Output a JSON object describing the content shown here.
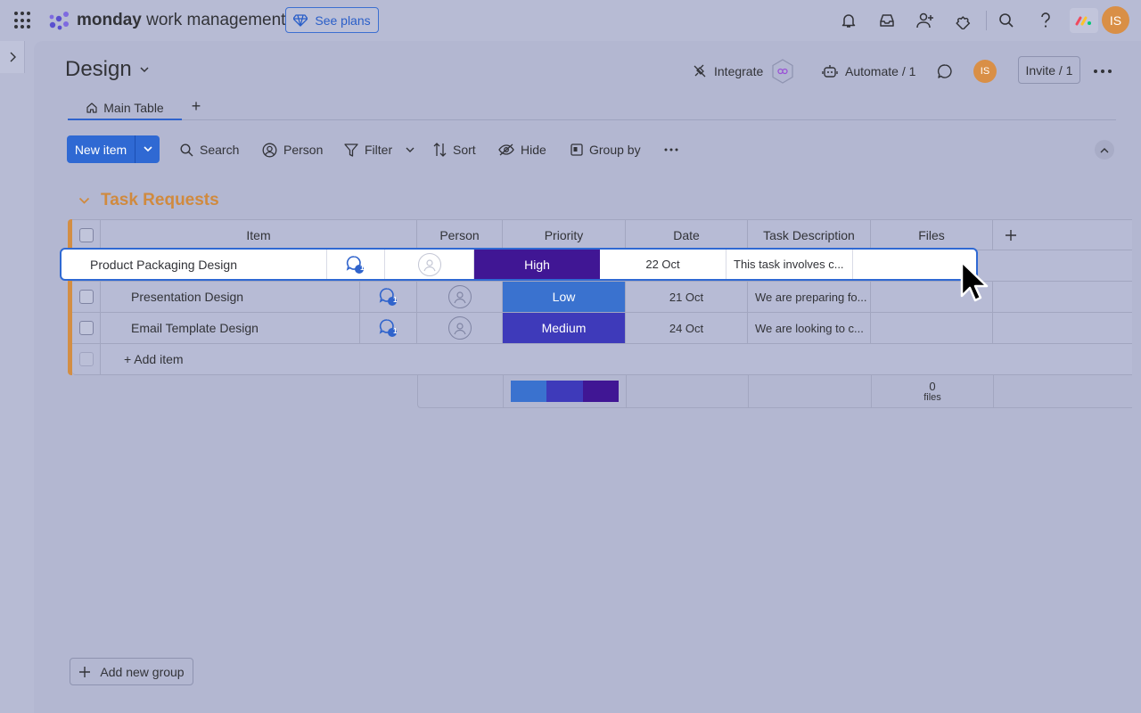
{
  "topbar": {
    "brand_bold": "monday",
    "brand_rest": " work management",
    "see_plans": "See plans",
    "avatar_initials": "IS"
  },
  "board": {
    "title": "Design",
    "integrate": "Integrate",
    "automate": "Automate / 1",
    "avatar_initials": "IS",
    "invite": "Invite / 1",
    "tabs": {
      "main": "Main Table",
      "add": "+"
    }
  },
  "toolbar": {
    "new_item": "New item",
    "search": "Search",
    "person": "Person",
    "filter": "Filter",
    "sort": "Sort",
    "hide": "Hide",
    "group_by": "Group by"
  },
  "group": {
    "title": "Task Requests",
    "columns": {
      "item": "Item",
      "person": "Person",
      "priority": "Priority",
      "date": "Date",
      "description": "Task Description",
      "files": "Files"
    },
    "rows": [
      {
        "name": "Product Packaging Design",
        "updates": "1",
        "priority": "High",
        "priority_color": "#401694",
        "date": "22 Oct",
        "description": "This task involves c..."
      },
      {
        "name": "Presentation Design",
        "updates": "1",
        "priority": "Low",
        "priority_color": "#3a72cf",
        "date": "21 Oct",
        "description": "We are preparing fo..."
      },
      {
        "name": "Email Template Design",
        "updates": "1",
        "priority": "Medium",
        "priority_color": "#3e3aba",
        "date": "24 Oct",
        "description": "We are looking to c..."
      }
    ],
    "add_item": "+ Add item",
    "summary": {
      "files_count": "0",
      "files_label": "files",
      "priority_distribution": [
        {
          "label": "Low",
          "color": "#3a72cf",
          "fraction": 0.333
        },
        {
          "label": "Medium",
          "color": "#3e3aba",
          "fraction": 0.333
        },
        {
          "label": "High",
          "color": "#401694",
          "fraction": 0.334
        }
      ]
    }
  },
  "add_group": "Add new group"
}
